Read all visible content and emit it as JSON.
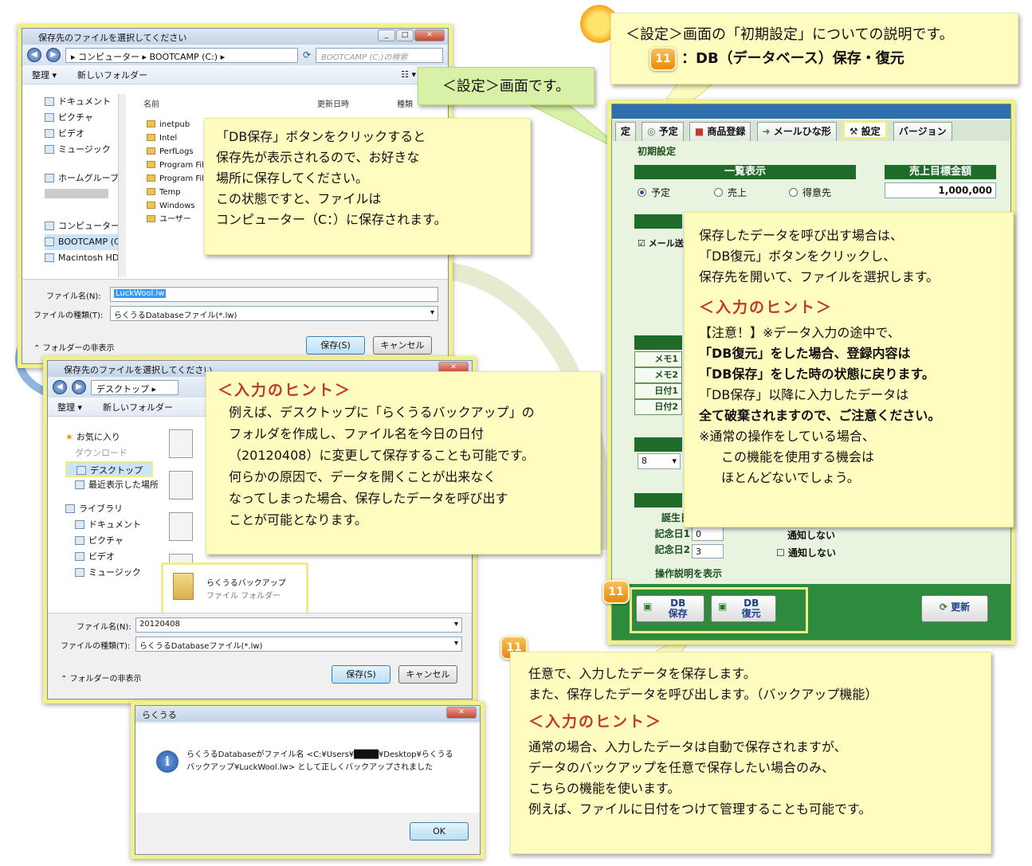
{
  "dlg1": {
    "title": "保存先のファイルを選択してください",
    "path": [
      "コンピューター",
      "BOOTCAMP (C:)"
    ],
    "search_placeholder": "BOOTCAMP (C:)の検索",
    "organize": "整理 ▾",
    "new_folder": "新しいフォルダー",
    "nav": [
      "ドキュメント",
      "ピクチャ",
      "ビデオ",
      "ミュージック",
      "ホームグループ",
      "コンピューター",
      "BOOTCAMP (C:",
      "Macintosh HD ("
    ],
    "col_name": "名前",
    "col_date": "更新日時",
    "col_type": "種類",
    "files": [
      "inetpub",
      "Intel",
      "PerfLogs",
      "Program Fil",
      "Program Fil",
      "Temp",
      "Windows",
      "ユーザー"
    ],
    "filename_label": "ファイル名(N):",
    "filename": "LuckWool.lw",
    "filetype_label": "ファイルの種類(T):",
    "filetype": "らくうるDatabaseファイル(*.lw)",
    "hide_folders": "フォルダーの非表示",
    "save": "保存(S)",
    "cancel": "キャンセル"
  },
  "dlg2": {
    "title": "保存先のファイルを選択してください",
    "path": "デスクトップ",
    "organize": "整理 ▾",
    "new_folder": "新しいフォルダー",
    "nav": [
      "お気に入り",
      "ダウンロード",
      "デスクトップ",
      "最近表示した場所",
      "ライブラリ",
      "ドキュメント",
      "ピクチャ",
      "ビデオ",
      "ミュージック"
    ],
    "folder_name": "らくうるバックアップ",
    "folder_type": "ファイル フォルダー",
    "filename_label": "ファイル名(N):",
    "filename": "20120408",
    "filetype_label": "ファイルの種類(T):",
    "filetype": "らくうるDatabaseファイル(*.lw)",
    "hide_folders": "フォルダーの非表示",
    "save": "保存(S)",
    "cancel": "キャンセル"
  },
  "msgbox": {
    "title": "らくうる",
    "message": "らくうるDatabaseがファイル名 <C:¥Users¥████¥Desktop¥らくうるバックアップ¥LuckWool.lw> として正しくバックアップされました",
    "ok": "OK"
  },
  "app": {
    "tabs": [
      "定",
      "予定",
      "商品登録",
      "メールひな形",
      "設定",
      "バージョン"
    ],
    "section": "初期設定",
    "list_header": "一覧表示",
    "radios": [
      "予定",
      "売上",
      "得意先"
    ],
    "sales_header": "売上目標金額",
    "sales_value": "1,000,000",
    "mail_check": "メール送",
    "memo_rows": [
      "メモ1",
      "メモ2",
      "日付1",
      "日付2"
    ],
    "select_value": "8",
    "anniv_rows": [
      "誕生日",
      "記念日1",
      "記念日2"
    ],
    "anniv_vals": [
      "",
      "0",
      "3"
    ],
    "notify": "通知しない",
    "op_help": "操作説明を表示",
    "db_save": [
      "DB",
      "保存"
    ],
    "db_restore": [
      "DB",
      "復元"
    ],
    "update": "更新"
  },
  "callouts": {
    "top_header_line1": "＜設定＞画面の「初期設定」についての説明です。",
    "top_header_badge": "11",
    "top_header_line2": "：DB（データベース）保存・復元",
    "settings_screen": "＜設定＞画面です。",
    "dbsave_lines": [
      "「DB保存」ボタンをクリックすると",
      "保存先が表示されるので、お好きな",
      "場所に保存してください。",
      "この状態ですと、ファイルは",
      "コンピューター（C：）に保存されます。"
    ],
    "hint_title": "＜入力のヒント＞",
    "hint1_lines": [
      "例えば、デスクトップに「らくうるバックアップ」の",
      "フォルダを作成し、ファイル名を今日の日付",
      "（20120408）に変更して保存することも可能です。",
      "何らかの原因で、データを開くことが出来なく",
      "なってしまった場合、保存したデータを呼び出す",
      "ことが可能となります。"
    ],
    "restore_lines": [
      "保存したデータを呼び出す場合は、",
      "「DB復元」ボタンをクリックし、",
      "保存先を開いて、ファイルを選択します。"
    ],
    "restore_hint_lines": [
      "【注意！】※データ入力の途中で、",
      "「DB復元」をした場合、登録内容は",
      "「DB保存」をした時の状態に戻ります。",
      "「DB保存」以降に入力したデータは",
      "全て破棄されますので、ご注意ください。",
      "※通常の操作をしている場合、",
      "この機能を使用する機会は",
      "ほとんどないでしょう。"
    ],
    "badge": "11",
    "bottom_lines": [
      "任意で、入力したデータを保存します。",
      "また、保存したデータを呼び出します。（バックアップ機能）"
    ],
    "bottom_hint_lines": [
      "通常の場合、入力したデータは自動で保存されますが、",
      "データのバックアップを任意で保存したい場合のみ、",
      "こちらの機能を使います。",
      "例えば、ファイルに日付をつけて管理することも可能です。"
    ]
  },
  "colors": {
    "callout_bg": "#fefcbf",
    "frame": "#f2f08a",
    "hint": "#c0392b",
    "app_green": "#1f6b2a"
  }
}
